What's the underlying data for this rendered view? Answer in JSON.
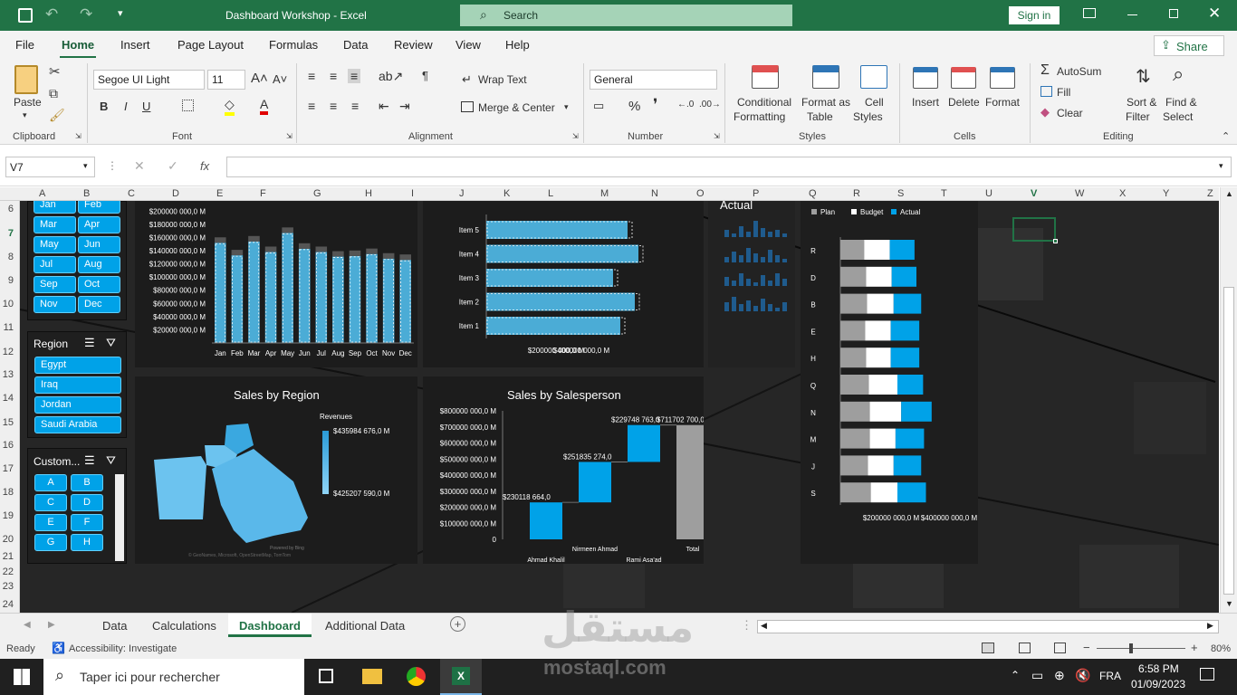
{
  "window": {
    "title": "Dashboard Workshop  -  Excel",
    "search": "Search",
    "signin": "Sign in"
  },
  "menu": [
    "File",
    "Home",
    "Insert",
    "Page Layout",
    "Formulas",
    "Data",
    "Review",
    "View",
    "Help"
  ],
  "share": "Share",
  "ribbon": {
    "paste": "Paste",
    "font_name": "Segoe UI Light",
    "font_size": "11",
    "wrap_text": "Wrap Text",
    "merge_center": "Merge & Center",
    "number_format": "General",
    "conditional": [
      "Conditional",
      "Formatting"
    ],
    "format_table": [
      "Format as",
      "Table"
    ],
    "cell_styles": [
      "Cell",
      "Styles"
    ],
    "insert": "Insert",
    "delete": "Delete",
    "format": "Format",
    "autosum": "AutoSum",
    "fill": "Fill",
    "clear": "Clear",
    "sort": [
      "Sort &",
      "Filter"
    ],
    "find": [
      "Find &",
      "Select"
    ],
    "groups": {
      "clipboard": "Clipboard",
      "font": "Font",
      "alignment": "Alignment",
      "number": "Number",
      "styles": "Styles",
      "cells": "Cells",
      "editing": "Editing"
    }
  },
  "namebox": "V7",
  "fx": "fx",
  "columns": [
    "A",
    "B",
    "C",
    "D",
    "E",
    "F",
    "G",
    "H",
    "I",
    "J",
    "K",
    "L",
    "M",
    "N",
    "O",
    "P",
    "Q",
    "R",
    "S",
    "T",
    "U",
    "V",
    "W",
    "X",
    "Y",
    "Z"
  ],
  "rows": [
    "6",
    "7",
    "8",
    "9",
    "10",
    "11",
    "12",
    "13",
    "14",
    "15",
    "16",
    "17",
    "18",
    "19",
    "20",
    "21",
    "22",
    "23",
    "24"
  ],
  "slicers": {
    "months": [
      "Jan",
      "Feb",
      "Mar",
      "Apr",
      "May",
      "Jun",
      "Jul",
      "Aug",
      "Sep",
      "Oct",
      "Nov",
      "Dec"
    ],
    "region_title": "Region",
    "regions": [
      "Egypt",
      "Iraq",
      "Jordan",
      "Saudi Arabia"
    ],
    "customer_title": "Custom...",
    "customers": [
      "A",
      "B",
      "C",
      "D",
      "E",
      "F",
      "G",
      "H"
    ]
  },
  "charts": {
    "region_title": "Sales by Region",
    "region_legend": "Revenues",
    "region_max": "$435984 676,0 M",
    "region_min": "$425207 590,0 M",
    "map_credit_1": "Powered by Bing",
    "map_credit_2": "© GeoNames, Microsoft, OpenStreetMap, TomTom",
    "salesperson_title": "Sales by Salesperson",
    "actual_title": "Actual",
    "pba_legend": [
      "Plan",
      "Budget",
      "Actual"
    ]
  },
  "chart_data": [
    {
      "type": "bar",
      "title": "",
      "categories": [
        "Jan",
        "Feb",
        "Mar",
        "Apr",
        "May",
        "Jun",
        "Jul",
        "Aug",
        "Sep",
        "Oct",
        "Nov",
        "Dec"
      ],
      "series": [
        {
          "values": [
            152000,
            133000,
            154000,
            138000,
            167000,
            143000,
            138000,
            131000,
            132000,
            135000,
            128000,
            126000
          ]
        }
      ],
      "ytick_labels": [
        "$200000 000,0  M",
        "$180000 000,0  M",
        "$160000 000,0  M",
        "$140000 000,0  M",
        "$120000 000,0  M",
        "$100000 000,0  M",
        "$80000 000,0  M",
        "$60000 000,0  M",
        "$40000 000,0  M",
        "$20000 000,0  M"
      ],
      "ylim": [
        0,
        210000
      ]
    },
    {
      "type": "bar",
      "orientation": "horizontal",
      "categories": [
        "Item 5",
        "Item 4",
        "Item 3",
        "Item 2",
        "Item 1"
      ],
      "series": [
        {
          "values": [
            390000,
            420000,
            350000,
            410000,
            370000
          ]
        }
      ],
      "xtick_labels": [
        "$200000 000,0  M",
        "$400000 000,0  M"
      ],
      "xlim": [
        0,
        500000
      ]
    },
    {
      "type": "bar",
      "subtype": "waterfall",
      "title": "Sales by Salesperson",
      "categories": [
        "Ahmad Khalil",
        "Nirmeen Ahmad",
        "Rami Asa'ad",
        "",
        "Total"
      ],
      "values": [
        230118664,
        251835274,
        229748763,
        0,
        711702700
      ],
      "data_labels": [
        "$230118 664,0",
        "$251835 274,0",
        "$229748 763,0",
        "$711702 700,0"
      ],
      "ytick_labels": [
        "$800000 000,0  M",
        "$700000 000,0  M",
        "$600000 000,0  M",
        "$500000 000,0  M",
        "$400000 000,0  M",
        "$300000 000,0  M",
        "$200000 000,0  M",
        "$100000 000,0  M",
        "0"
      ],
      "ylim": [
        0,
        800000000
      ]
    },
    {
      "type": "bar",
      "orientation": "horizontal",
      "subtype": "stacked",
      "categories": [
        "R",
        "D",
        "B",
        "E",
        "H",
        "Q",
        "N",
        "M",
        "J",
        "S"
      ],
      "series": [
        {
          "name": "Plan",
          "values": [
            25,
            27,
            28,
            26,
            27,
            30,
            31,
            31,
            29,
            32
          ]
        },
        {
          "name": "Budget",
          "values": [
            27,
            27,
            28,
            27,
            26,
            30,
            33,
            27,
            27,
            28
          ]
        },
        {
          "name": "Actual",
          "values": [
            26,
            26,
            29,
            30,
            30,
            27,
            32,
            30,
            29,
            30
          ]
        }
      ],
      "xtick_labels": [
        "$200000 000,0  M",
        "$400000 000,0  M"
      ]
    }
  ],
  "sheet_tabs": [
    "Data",
    "Calculations",
    "Dashboard",
    "Additional Data"
  ],
  "status": {
    "ready": "Ready",
    "accessibility": "Accessibility: Investigate",
    "zoom": "80%"
  },
  "taskbar": {
    "search": "Taper ici pour rechercher",
    "lang": "FRA",
    "time": "6:58 PM",
    "date": "01/09/2023"
  },
  "watermark": {
    "arabic": "مستقل",
    "latin": "mostaql.com"
  }
}
